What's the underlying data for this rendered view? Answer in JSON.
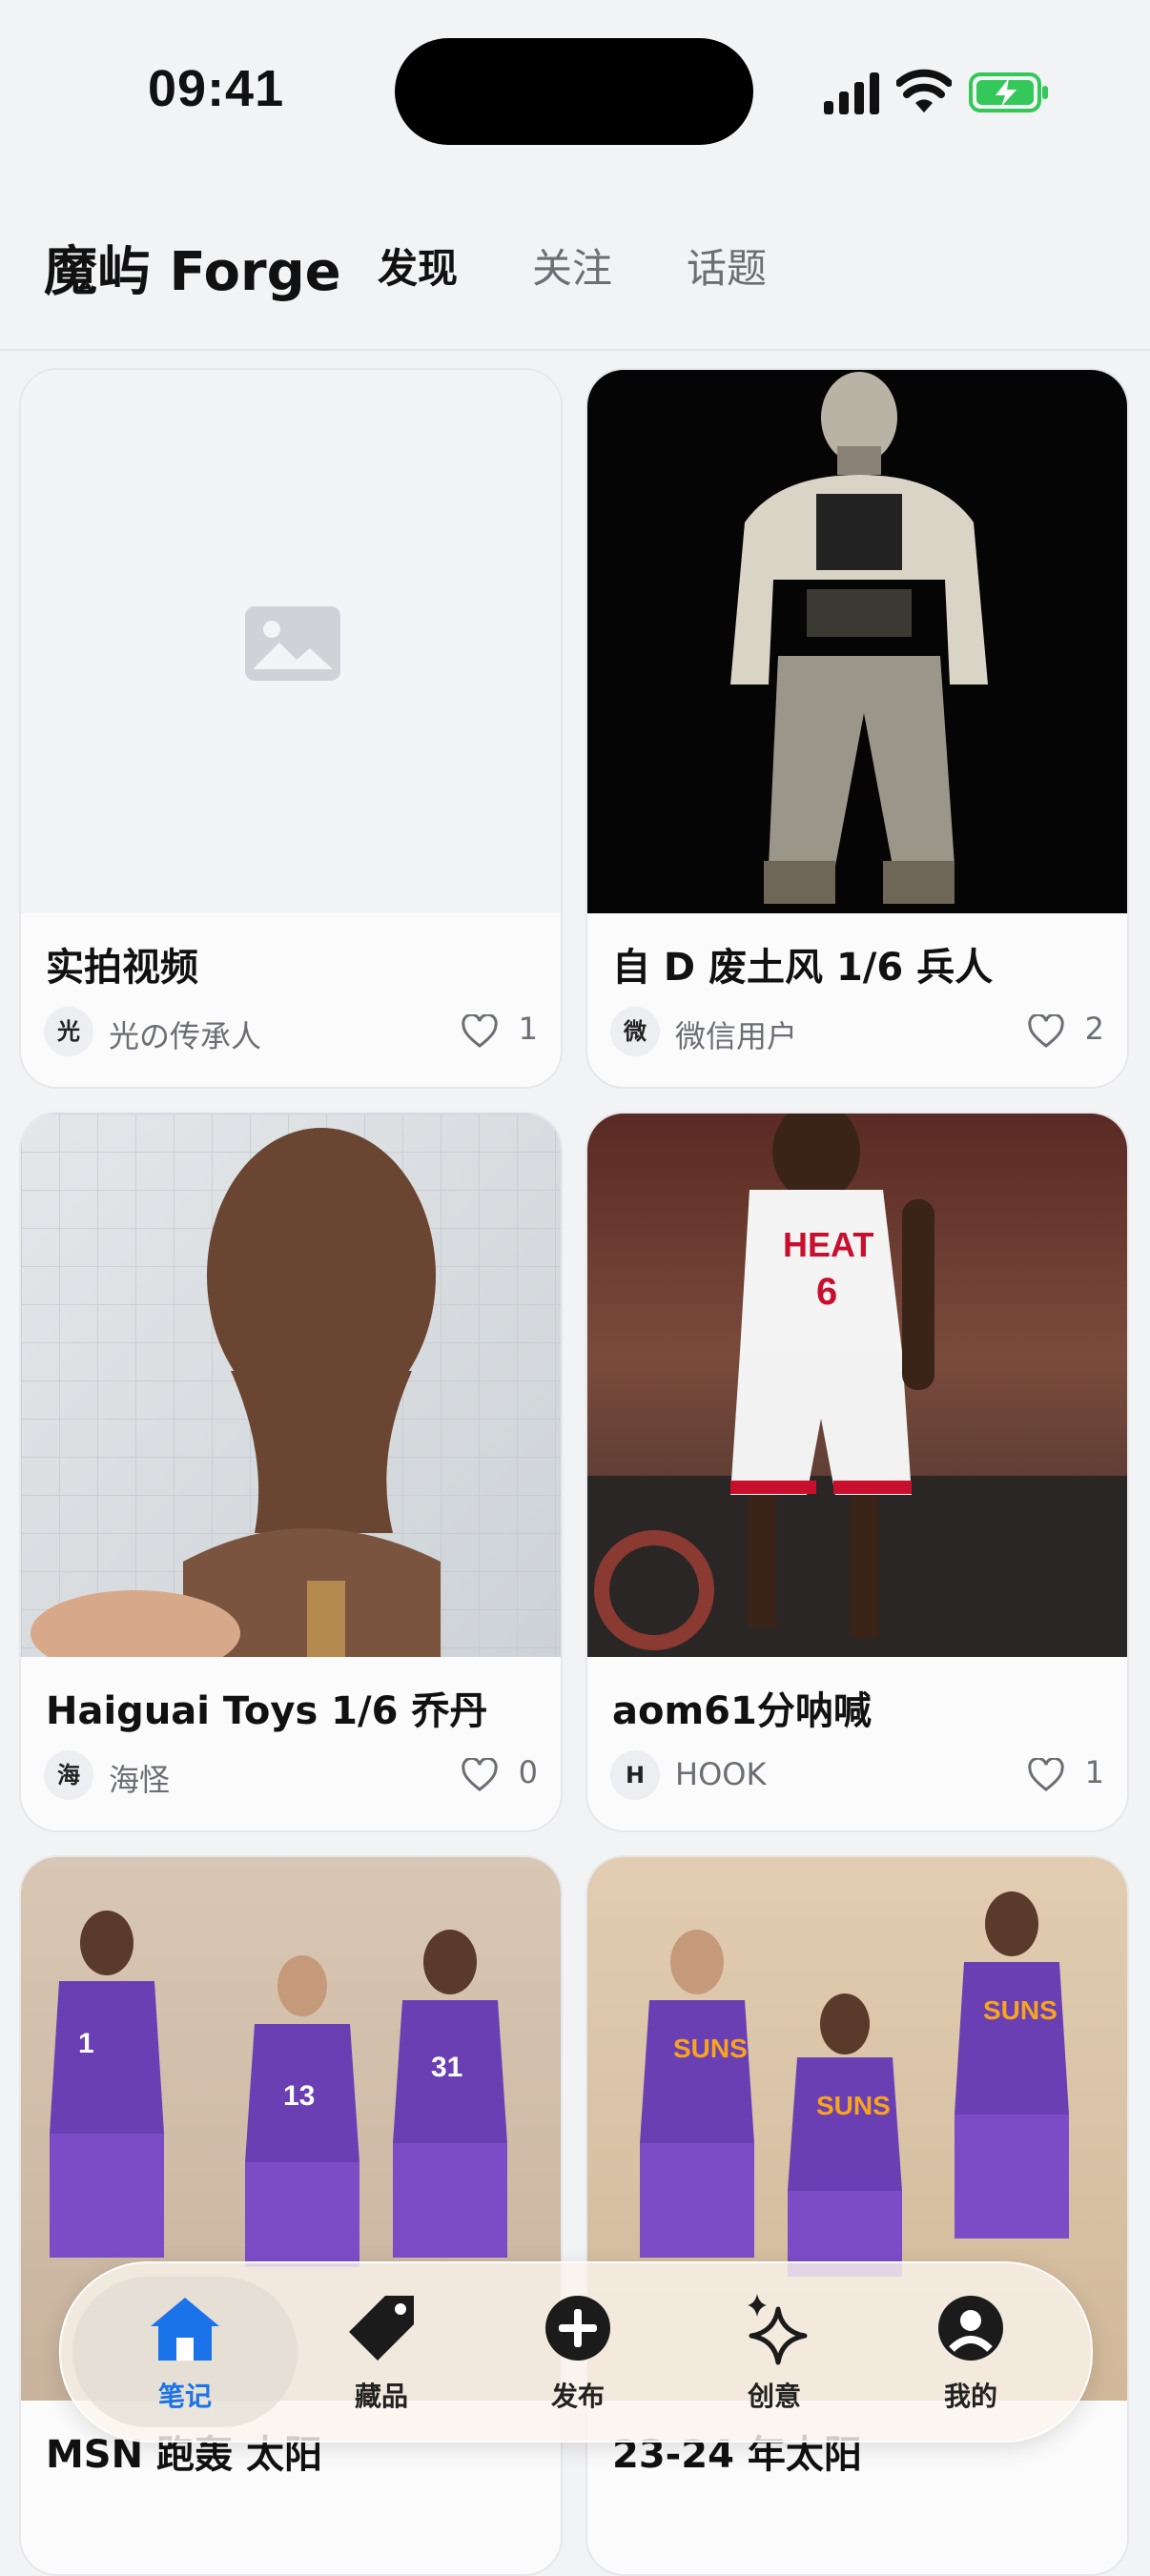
{
  "status": {
    "time": "09:41"
  },
  "header": {
    "logo": "魔屿 Forge",
    "tabs": [
      {
        "label": "发现",
        "active": true
      },
      {
        "label": "关注",
        "active": false
      },
      {
        "label": "话题",
        "active": false
      }
    ]
  },
  "feed": [
    {
      "title": "实拍视频",
      "avatar": "光",
      "user": "光の传承人",
      "likes": "1",
      "image": "placeholder-image"
    },
    {
      "title": "自 D 废土风 1/6 兵人",
      "avatar": "微",
      "user": "微信用户",
      "likes": "2",
      "image": "figure-wasteland"
    },
    {
      "title": "Haiguai Toys 1/6 乔丹",
      "avatar": "海",
      "user": "海怪",
      "likes": "0",
      "image": "head-sculpt"
    },
    {
      "title": "aom61分呐喊",
      "avatar": "H",
      "user": "HOOK",
      "likes": "1",
      "image": "basketball-figure-heat"
    },
    {
      "title": "MSN 跑轰 太阳",
      "image": "three-figures-suns"
    },
    {
      "title": "23-24 年太阳",
      "image": "three-figures-suns-2"
    }
  ],
  "tabbar": {
    "items": [
      {
        "label": "笔记",
        "icon": "home-icon",
        "active": true
      },
      {
        "label": "藏品",
        "icon": "tag-icon",
        "active": false
      },
      {
        "label": "发布",
        "icon": "plus-circle-icon",
        "active": false
      },
      {
        "label": "创意",
        "icon": "sparkle-icon",
        "active": false
      },
      {
        "label": "我的",
        "icon": "user-icon",
        "active": false
      }
    ]
  },
  "colors": {
    "accent": "#1a73e8",
    "background": "#f2f3f5",
    "battery": "#34c759"
  }
}
